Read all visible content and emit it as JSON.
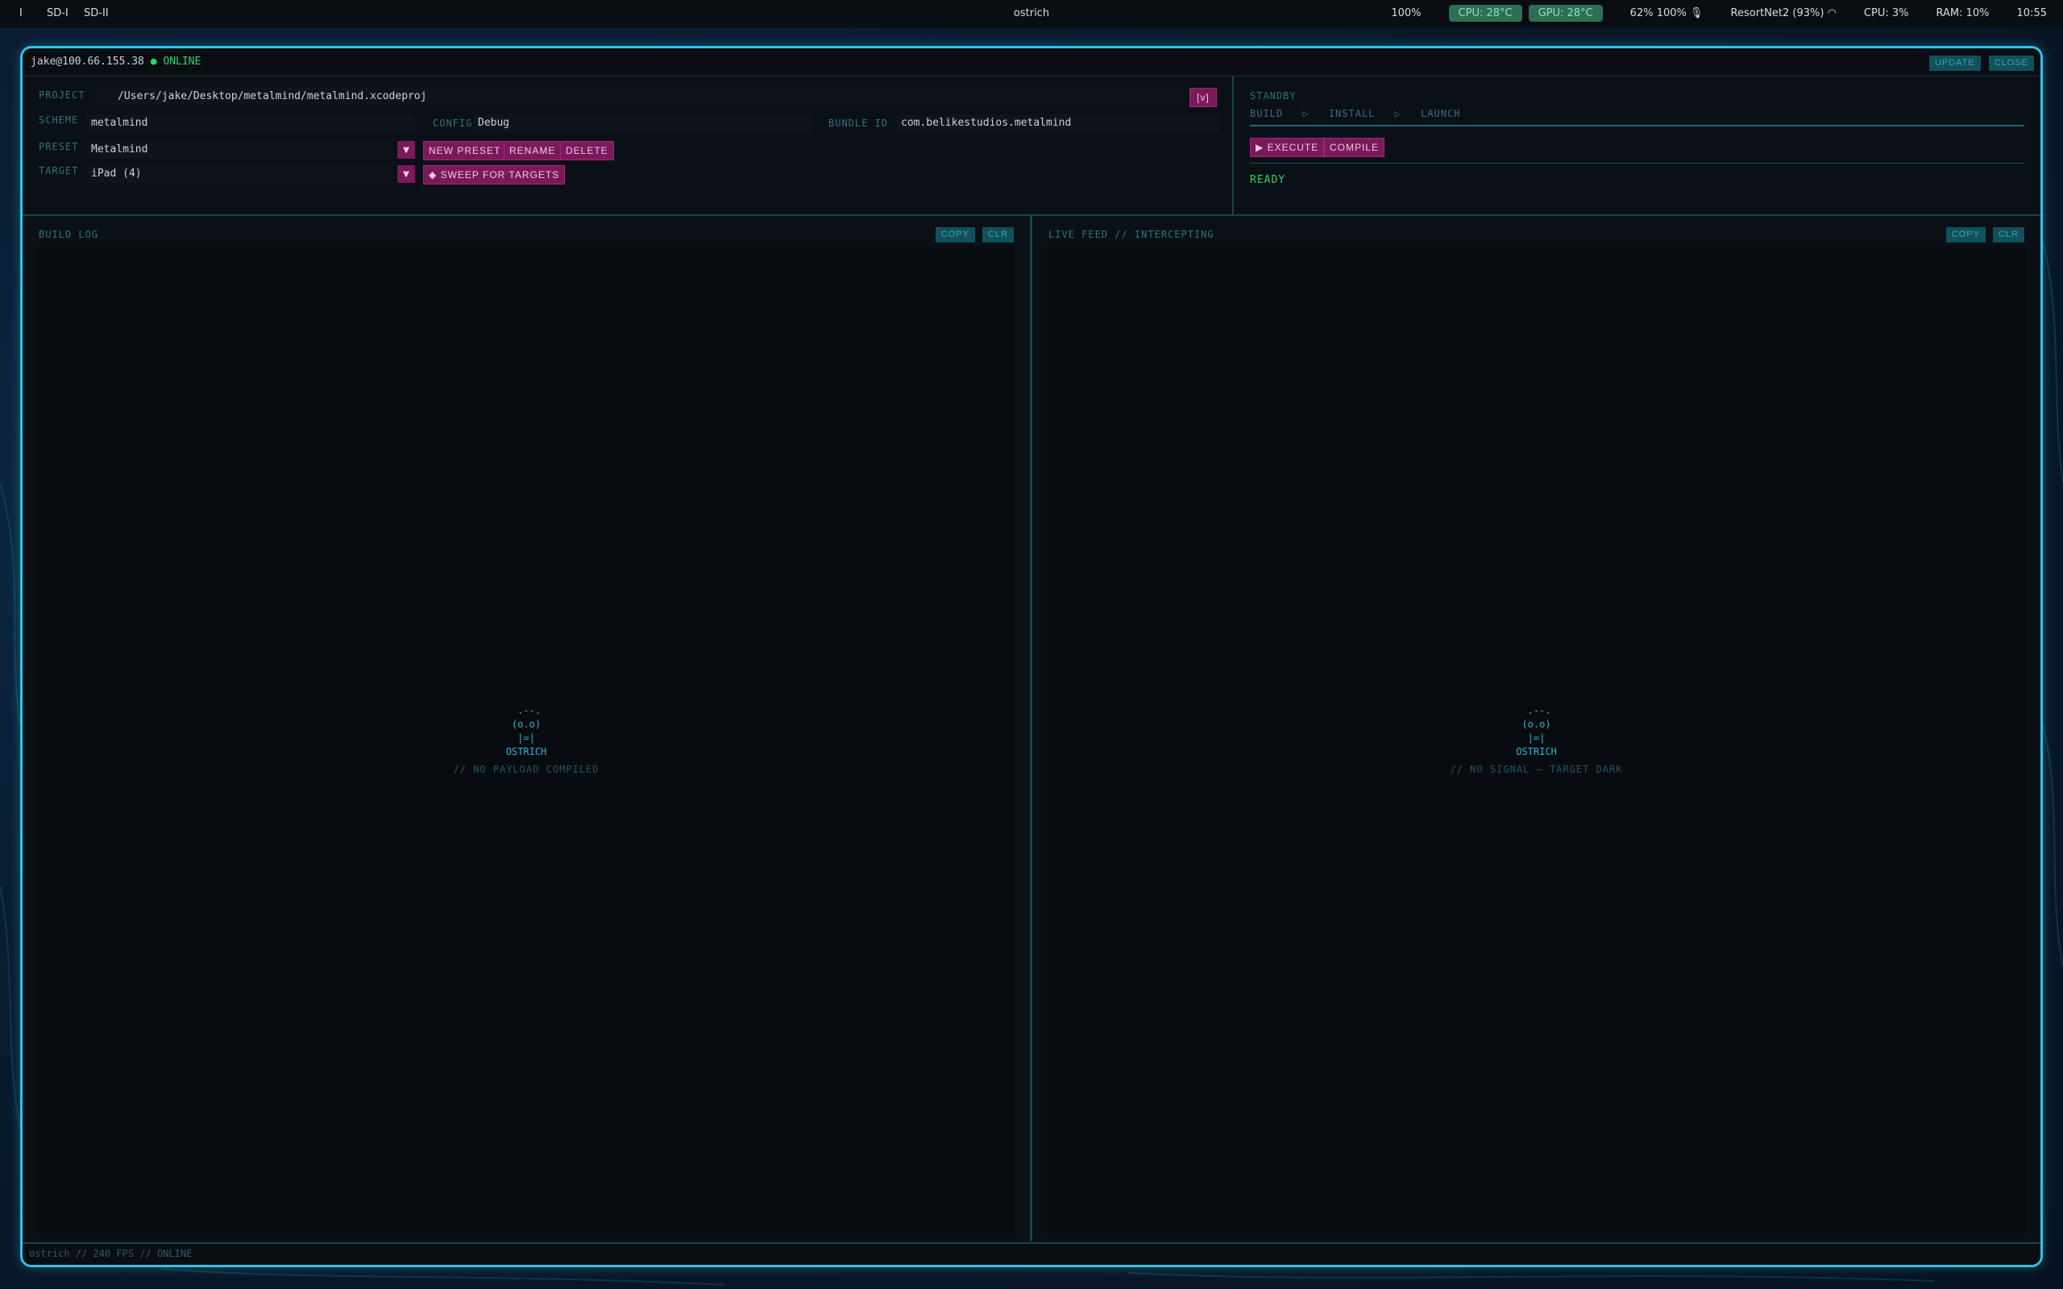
{
  "menubar": {
    "workspaces": [
      "I",
      "SD-I",
      "SD-II"
    ],
    "title": "ostrich",
    "zoom": "100%",
    "cpu_temp": "CPU: 28°C",
    "gpu_temp": "GPU: 28°C",
    "volume": "62%",
    "mic": "100%",
    "wifi": "ResortNet2 (93%)",
    "cpu_usage": "CPU: 3%",
    "ram": "RAM: 10%",
    "clock": "10:55"
  },
  "titlebar": {
    "host": "jake@100.66.155.38",
    "status": "● ONLINE",
    "update_label": "UPDATE",
    "close_label": "CLOSE"
  },
  "config": {
    "project_label": "PROJECT",
    "project_value": "/Users/jake/Desktop/metalmind/metalmind.xcodeproj",
    "project_menu": "[v]",
    "scheme_label": "SCHEME",
    "scheme_value": "metalmind",
    "config_label": "CONFIG",
    "config_value": "Debug",
    "bundle_label": "BUNDLE ID",
    "bundle_value": "com.belikestudios.metalmind",
    "preset_label": "PRESET",
    "preset_value": "Metalmind",
    "new_preset": "NEW PRESET",
    "rename": "RENAME",
    "delete": "DELETE",
    "target_label": "TARGET",
    "target_value": "iPad (4)",
    "sweep": "◆ SWEEP FOR TARGETS"
  },
  "pipeline": {
    "state": "STANDBY",
    "stages": [
      "BUILD",
      "▷",
      "INSTALL",
      "▷",
      "LAUNCH"
    ],
    "execute": "▶ EXECUTE",
    "compile": "COMPILE",
    "status": "READY"
  },
  "build_log": {
    "title": "BUILD LOG",
    "copy": "COPY",
    "clear": "CLR",
    "ascii": " .--.\n(o.o)\n |=| \nOSTRICH",
    "empty": "// NO PAYLOAD COMPILED"
  },
  "live_feed": {
    "title": "LIVE FEED // INTERCEPTING",
    "copy": "COPY",
    "clear": "CLR",
    "ascii": " .--.\n(o.o)\n |=| \nOSTRICH",
    "empty": "// NO SIGNAL — TARGET DARK"
  },
  "statusbar": {
    "text": "ostrich // 240 FPS // ONLINE"
  },
  "colors": {
    "accent": "#2ec4e6",
    "magenta": "#7a1a5a",
    "online": "#2fd06f"
  }
}
